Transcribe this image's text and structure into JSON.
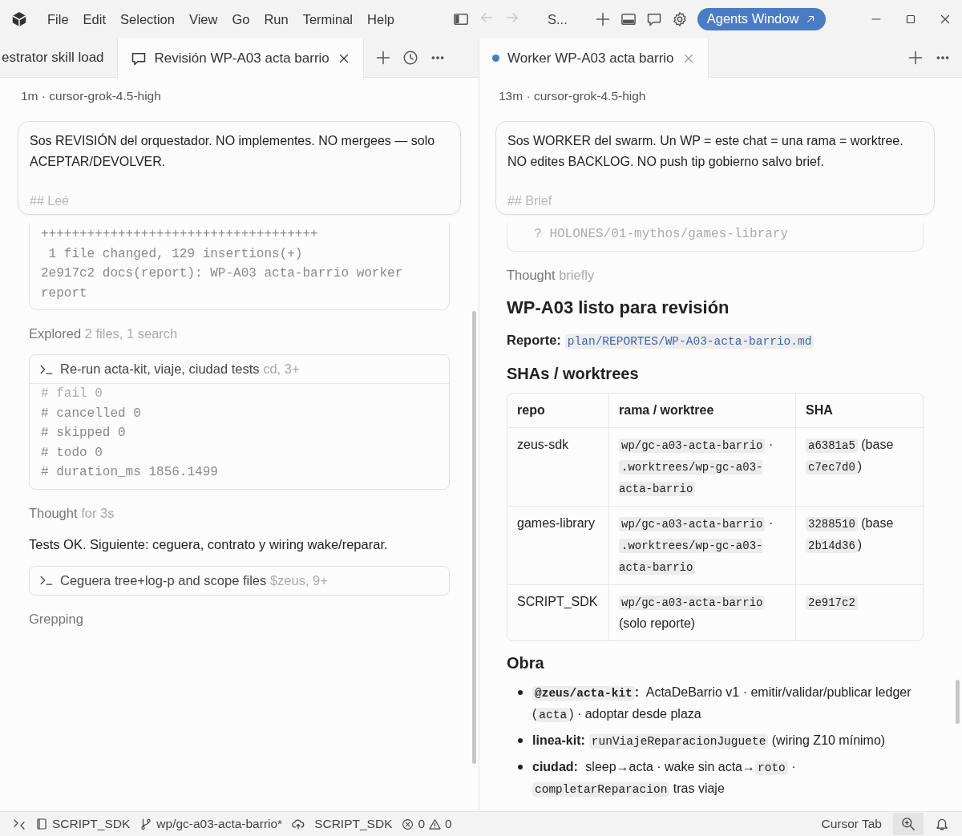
{
  "title_bar": {
    "menu": [
      "File",
      "Edit",
      "Selection",
      "View",
      "Go",
      "Run",
      "Terminal",
      "Help"
    ],
    "nav": [
      {
        "kind": "back",
        "disabled": true
      },
      {
        "kind": "forward",
        "disabled": true
      }
    ],
    "command_center": "S...",
    "agents_button": "Agents Window"
  },
  "panes": [
    {
      "tabs": [
        {
          "label": "estrator skill load",
          "selected": false,
          "kind": "plain",
          "running": false
        },
        {
          "label": "Revisión WP-A03 acta barrio",
          "selected": true,
          "kind": "chat",
          "running": false
        }
      ],
      "actions": [
        {
          "kind": "new"
        },
        {
          "kind": "history"
        },
        {
          "kind": "more"
        }
      ],
      "meta": "1m · cursor-grok-4.5-high",
      "prompt": {
        "text": "Sos REVISIÓN del orquestador. NO implementes. NO mergees — solo ACEPTAR/DEVOLVER.",
        "cut_line": "## Leé"
      },
      "blocks": [
        {
          "kind": "code",
          "lines": [
            {
              "text": "++++++++++++++++++++++++++++++++++++",
              "faded": false
            },
            {
              "text": " 1 file changed, 129 insertions(+)",
              "faded": false
            },
            {
              "text": "2e917c2 docs(report): WP-A03 acta-barrio worker report",
              "faded": false
            }
          ]
        },
        {
          "kind": "activity",
          "label": "Explored",
          "detail": "2 files, 1 search"
        },
        {
          "kind": "tool",
          "title": "Re-run acta-kit, viaje, ciudad tests",
          "detail": "cd, 3+",
          "expanded": true,
          "lines": [
            {
              "text": "# fail 0",
              "faded": true
            },
            {
              "text": "# cancelled 0",
              "faded": false
            },
            {
              "text": "# skipped 0",
              "faded": false
            },
            {
              "text": "# todo 0",
              "faded": false
            },
            {
              "text": "# duration_ms 1856.1499",
              "faded": false
            }
          ]
        },
        {
          "kind": "activity",
          "label": "Thought",
          "detail": "for 3s"
        },
        {
          "kind": "paragraph",
          "segments": [
            {
              "kind": "text",
              "text": "Tests OK. Siguiente: ceguera, contrato y wiring wake/reparar."
            }
          ]
        },
        {
          "kind": "tool",
          "title": "Ceguera tree+log-p and scope files",
          "detail": "$zeus, 9+",
          "expanded": false
        },
        {
          "kind": "activity",
          "label": "Grepping"
        }
      ]
    },
    {
      "tabs": [
        {
          "label": "Worker WP-A03 acta barrio",
          "selected": true,
          "kind": "plain",
          "running": true
        }
      ],
      "actions": [
        {
          "kind": "new"
        },
        {
          "kind": "more"
        }
      ],
      "meta": "13m · cursor-grok-4.5-high",
      "prompt": {
        "text": "Sos WORKER del swarm. Un WP = este chat = una rama = worktree. NO edites BACKLOG. NO push tip gobierno salvo brief.",
        "cut_line": "## Brief"
      },
      "blocks": [
        {
          "kind": "code",
          "lines": [
            {
              "text": "  ? HOLONES/01-mythos/games-library",
              "faded": true
            }
          ]
        },
        {
          "kind": "activity",
          "label": "Thought",
          "detail": "briefly"
        },
        {
          "kind": "title",
          "text": "WP-A03 listo para revisión"
        },
        {
          "kind": "paragraph",
          "segments": [
            {
              "kind": "bold",
              "text": "Reporte:"
            },
            {
              "kind": "link_code",
              "text": "plan/REPORTES/WP-A03-acta-barrio.md"
            }
          ]
        },
        {
          "kind": "subtitle",
          "text": "SHAs / worktrees"
        },
        {
          "kind": "table",
          "columns": [
            "repo",
            "rama / worktree",
            "SHA"
          ],
          "rows": [
            [
              [
                {
                  "kind": "text",
                  "text": "zeus-sdk"
                }
              ],
              [
                {
                  "kind": "code",
                  "text": "wp/gc-a03-acta-barrio"
                },
                {
                  "kind": "text",
                  "text": " · "
                },
                {
                  "kind": "code",
                  "text": ".worktrees/wp-gc-a03-acta-barrio"
                }
              ],
              [
                {
                  "kind": "code",
                  "text": "a6381a5"
                },
                {
                  "kind": "text",
                  "text": " (base "
                },
                {
                  "kind": "code",
                  "text": "c7ec7d0"
                },
                {
                  "kind": "text",
                  "text": ")"
                }
              ]
            ],
            [
              [
                {
                  "kind": "text",
                  "text": "games-library"
                }
              ],
              [
                {
                  "kind": "code",
                  "text": "wp/gc-a03-acta-barrio"
                },
                {
                  "kind": "text",
                  "text": " · "
                },
                {
                  "kind": "code",
                  "text": ".worktrees/wp-gc-a03-acta-barrio"
                }
              ],
              [
                {
                  "kind": "code",
                  "text": "3288510"
                },
                {
                  "kind": "text",
                  "text": " (base "
                },
                {
                  "kind": "code",
                  "text": "2b14d36"
                },
                {
                  "kind": "text",
                  "text": ")"
                }
              ]
            ],
            [
              [
                {
                  "kind": "text",
                  "text": "SCRIPT_SDK"
                }
              ],
              [
                {
                  "kind": "code",
                  "text": "wp/gc-a03-acta-barrio"
                },
                {
                  "kind": "text",
                  "text": " (solo reporte)"
                }
              ],
              [
                {
                  "kind": "code",
                  "text": "2e917c2"
                }
              ]
            ]
          ]
        },
        {
          "kind": "subtitle",
          "text": "Obra"
        },
        {
          "kind": "list",
          "items": [
            [
              {
                "kind": "bold_code",
                "text": "@zeus/acta-kit"
              },
              {
                "kind": "bold",
                "text": ":"
              },
              {
                "kind": "text",
                "text": " ActaDeBarrio v1 · emitir/validar/publicar ledger ("
              },
              {
                "kind": "code",
                "text": "acta"
              },
              {
                "kind": "text",
                "text": ") · adoptar desde plaza"
              }
            ],
            [
              {
                "kind": "bold",
                "text": "linea-kit:"
              },
              {
                "kind": "code",
                "text": "runViajeReparacionJuguete"
              },
              {
                "kind": "text",
                "text": " (wiring Z10 mínimo)"
              }
            ],
            [
              {
                "kind": "bold",
                "text": "ciudad:"
              },
              {
                "kind": "text",
                "text": " sleep→acta · wake sin acta→"
              },
              {
                "kind": "code",
                "text": "roto"
              },
              {
                "kind": "text",
                "text": " · "
              },
              {
                "kind": "code",
                "text": "completarReparacion"
              },
              {
                "kind": "text",
                "text": " tras viaje"
              }
            ]
          ]
        }
      ]
    }
  ],
  "status_bar": {
    "left": [
      {
        "kind": "remote"
      },
      {
        "kind": "repo",
        "text": "SCRIPT_SDK"
      },
      {
        "kind": "branch",
        "text": "wp/gc-a03-acta-barrio*"
      },
      {
        "kind": "sync"
      },
      {
        "kind": "text",
        "text": "SCRIPT_SDK"
      },
      {
        "kind": "problems",
        "errors": "0",
        "warnings": "0"
      }
    ],
    "right": [
      {
        "kind": "text",
        "text": "Cursor Tab"
      },
      {
        "kind": "zoom"
      },
      {
        "kind": "bell"
      }
    ]
  }
}
